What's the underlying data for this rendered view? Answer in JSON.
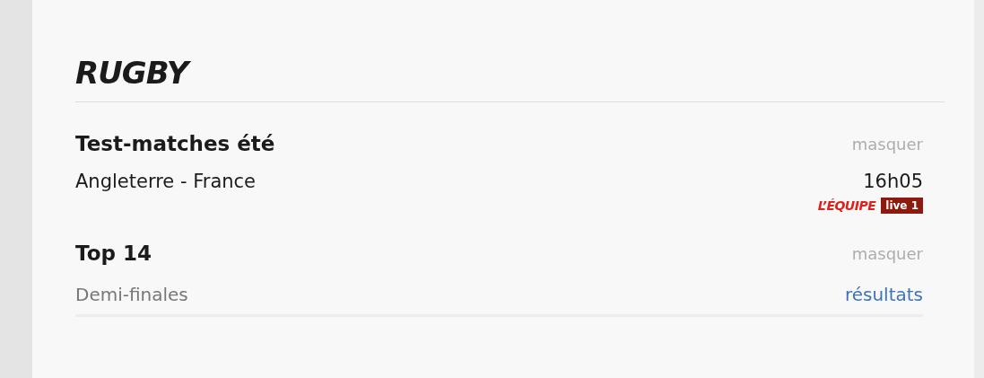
{
  "sport_title": "RUGBY",
  "competitions": [
    {
      "name": "Test-matches été",
      "toggle": "masquer",
      "matches": [
        {
          "teams": "Angleterre - France",
          "time": "16h05",
          "channel": {
            "brand": "L’ÉQUIPE",
            "badge": "live 1"
          }
        }
      ]
    },
    {
      "name": "Top 14",
      "toggle": "masquer",
      "rounds": [
        {
          "label": "Demi-finales",
          "link": "résultats"
        }
      ]
    }
  ]
}
